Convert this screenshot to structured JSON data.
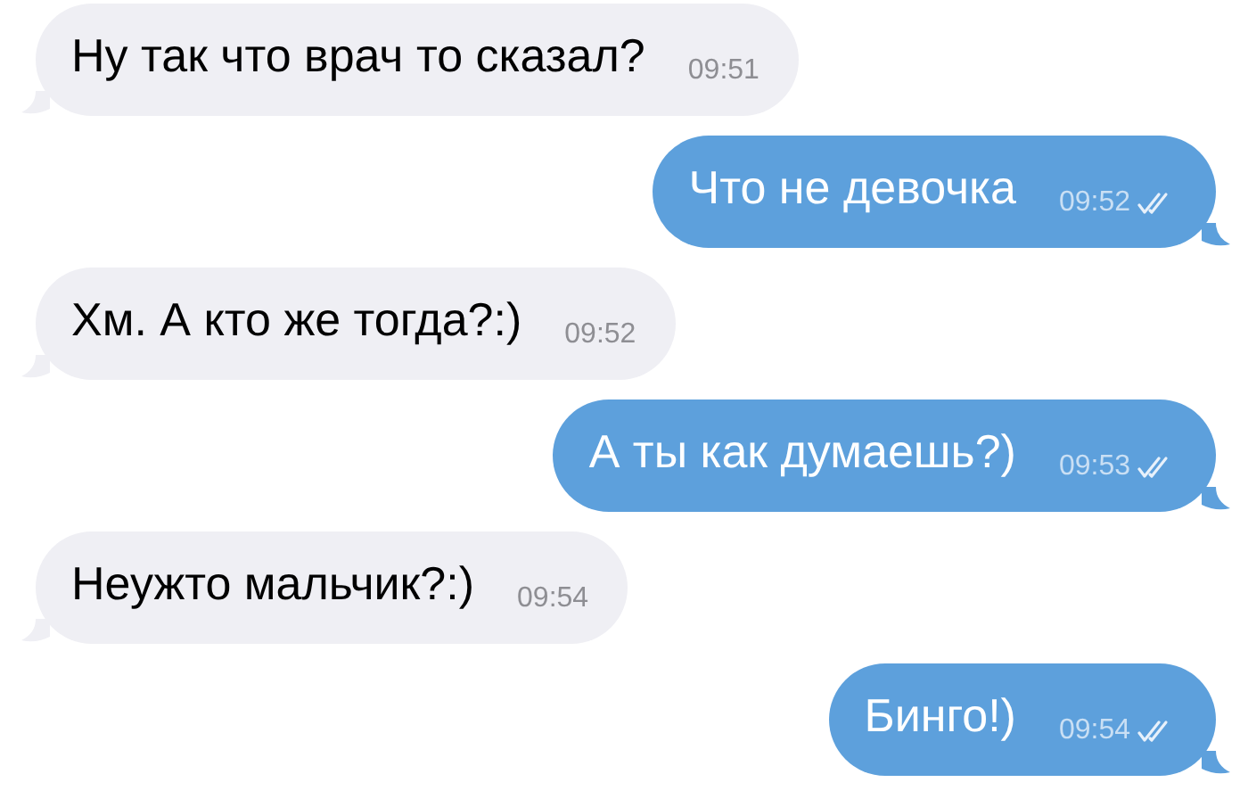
{
  "messages": [
    {
      "kind": "incoming",
      "text": "Ну так что врач то сказал?",
      "time": "09:51"
    },
    {
      "kind": "outgoing",
      "text": "Что не девочка",
      "time": "09:52",
      "read": true
    },
    {
      "kind": "incoming",
      "text": "Хм. А кто же тогда?:)",
      "time": "09:52"
    },
    {
      "kind": "outgoing",
      "text": "А ты как думаешь?)",
      "time": "09:53",
      "read": true
    },
    {
      "kind": "incoming",
      "text": "Неужто мальчик?:)",
      "time": "09:54"
    },
    {
      "kind": "outgoing",
      "text": "Бинго!)",
      "time": "09:54",
      "read": true
    }
  ]
}
